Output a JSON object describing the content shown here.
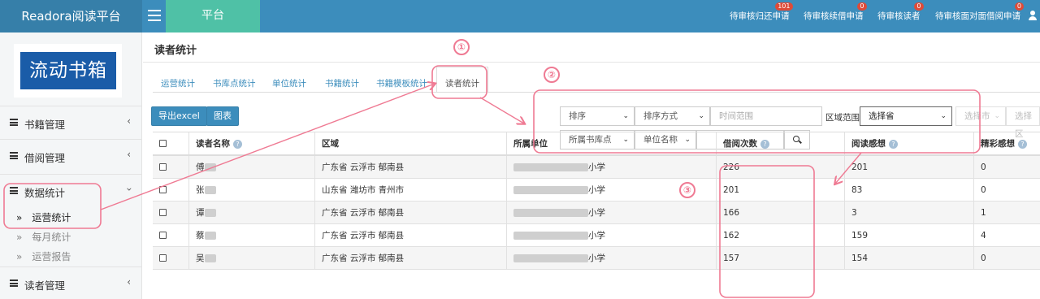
{
  "app": {
    "brand": "Readora阅读平台",
    "module_tab": "平台"
  },
  "notifications": [
    {
      "label": "待审核归还申请",
      "count": "101"
    },
    {
      "label": "待审核续借申请",
      "count": "0"
    },
    {
      "label": "待审核读者",
      "count": "0"
    },
    {
      "label": "待审核面对面借阅申请",
      "count": "0"
    }
  ],
  "sidebar": {
    "logo_text": "流动书箱",
    "items": [
      {
        "label": "书籍管理"
      },
      {
        "label": "借阅管理"
      },
      {
        "label": "数据统计"
      },
      {
        "label": "读者管理"
      }
    ],
    "sub_items": [
      {
        "label": "运营统计"
      },
      {
        "label": "每月统计"
      },
      {
        "label": "运营报告"
      }
    ]
  },
  "page": {
    "title": "读者统计",
    "tabs": [
      "运营统计",
      "书库点统计",
      "单位统计",
      "书籍统计",
      "书籍模板统计",
      "读者统计"
    ],
    "active_tab": "读者统计",
    "export_button": "导出excel",
    "chart_button": "图表"
  },
  "filters": {
    "sort": "排序",
    "sort_method": "排序方式",
    "time_range_placeholder": "时间范围",
    "region_label": "区域范围",
    "province": "选择省",
    "city": "选择市",
    "district": "选择区",
    "library_point": "所属书库点",
    "unit_name": "单位名称"
  },
  "table": {
    "headers": [
      "读者名称",
      "区域",
      "所属单位",
      "借阅次数",
      "阅读感想",
      "精彩感想"
    ],
    "rows": [
      {
        "name": "傅",
        "region": "广东省 云浮市 郁南县",
        "unit": "小学",
        "borrow": "226",
        "reviews": "201",
        "highlights": "0"
      },
      {
        "name": "张",
        "region": "山东省 潍坊市 青州市",
        "unit": "小学",
        "borrow": "201",
        "reviews": "83",
        "highlights": "0"
      },
      {
        "name": "谭",
        "region": "广东省 云浮市 郁南县",
        "unit": "小学",
        "borrow": "166",
        "reviews": "3",
        "highlights": "1"
      },
      {
        "name": "蔡",
        "region": "广东省 云浮市 郁南县",
        "unit": "小学",
        "borrow": "162",
        "reviews": "159",
        "highlights": "4"
      },
      {
        "name": "吴",
        "region": "广东省 云浮市 郁南县",
        "unit": "小学",
        "borrow": "157",
        "reviews": "154",
        "highlights": "0"
      }
    ]
  },
  "annotations": [
    "①",
    "②",
    "③"
  ],
  "colors": {
    "header_blue": "#3c8dbc",
    "module_green": "#4fc1a6",
    "annotation_pink": "#ef7a93",
    "logo_blue": "#1a5ca8"
  }
}
